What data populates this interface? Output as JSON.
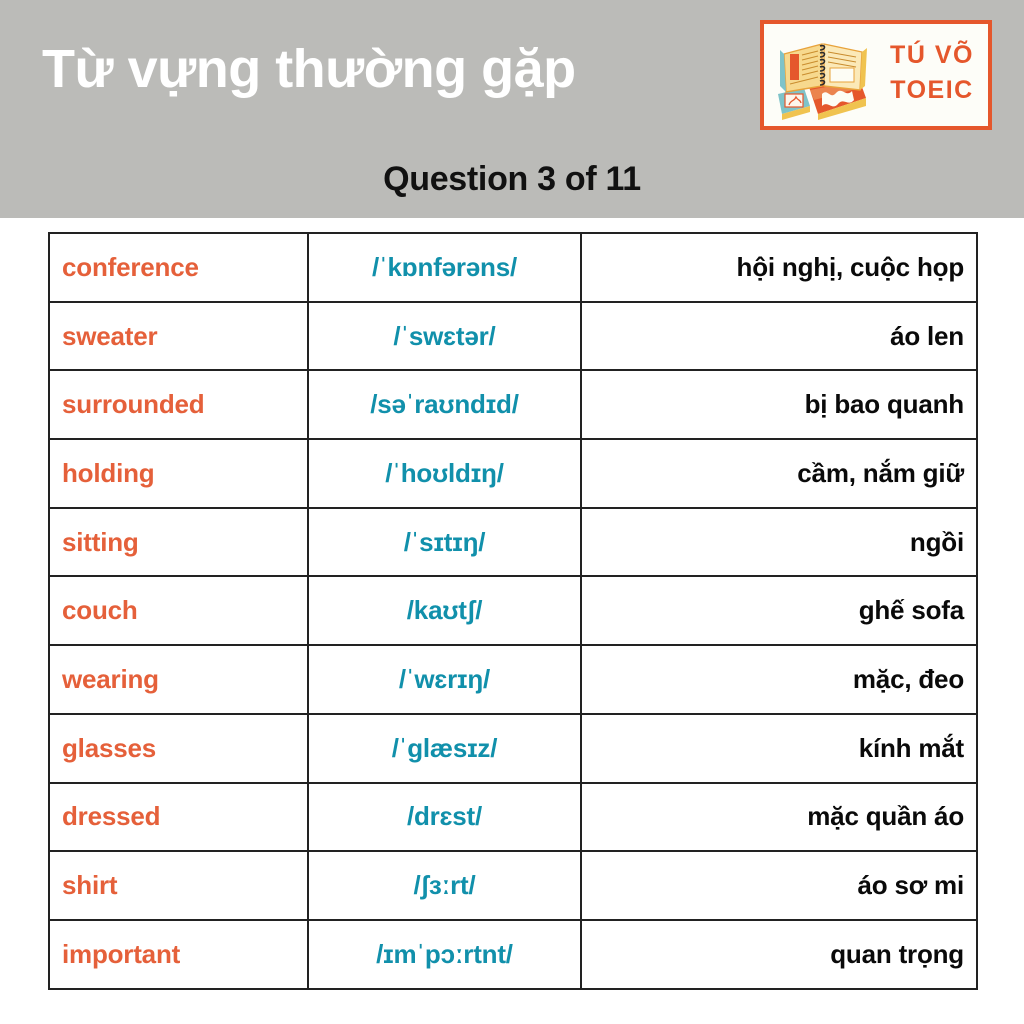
{
  "header": {
    "title": "Từ vựng thường gặp",
    "subtitle": "Question 3 of 11",
    "background_color": "#bbbbb8",
    "title_color": "#ffffff",
    "subtitle_color": "#111111"
  },
  "logo": {
    "line1": "TÚ VÕ",
    "line2": "TOEIC",
    "border_color": "#e5572c",
    "text_color": "#e5572c",
    "background_color": "#fdfdf8",
    "icon": "open-book-stack-icon"
  },
  "colors": {
    "word_orange": "#e5603a",
    "ipa_teal": "#1190ab",
    "meaning_black": "#0a0a0a",
    "table_border": "#222222"
  },
  "table": {
    "columns": [
      "word",
      "ipa",
      "meaning"
    ],
    "rows": [
      {
        "word": "conference",
        "ipa": "/ˈkɒnfərəns/",
        "meaning": "hội nghị, cuộc họp"
      },
      {
        "word": "sweater",
        "ipa": "/ˈswɛtər/",
        "meaning": "áo len"
      },
      {
        "word": "surrounded",
        "ipa": "/səˈraʊndɪd/",
        "meaning": "bị bao quanh"
      },
      {
        "word": "holding",
        "ipa": "/ˈhoʊldɪŋ/",
        "meaning": "cầm, nắm giữ"
      },
      {
        "word": "sitting",
        "ipa": "/ˈsɪtɪŋ/",
        "meaning": "ngồi"
      },
      {
        "word": "couch",
        "ipa": "/kaʊtʃ/",
        "meaning": "ghế sofa"
      },
      {
        "word": "wearing",
        "ipa": "/ˈwɛrɪŋ/",
        "meaning": "mặc, đeo"
      },
      {
        "word": "glasses",
        "ipa": "/ˈɡlæsɪz/",
        "meaning": "kính mắt"
      },
      {
        "word": "dressed",
        "ipa": "/drɛst/",
        "meaning": "mặc quần áo"
      },
      {
        "word": "shirt",
        "ipa": "/ʃɜːrt/",
        "meaning": "áo sơ mi"
      },
      {
        "word": "important",
        "ipa": "/ɪmˈpɔːrtnt/",
        "meaning": "quan trọng"
      }
    ]
  }
}
